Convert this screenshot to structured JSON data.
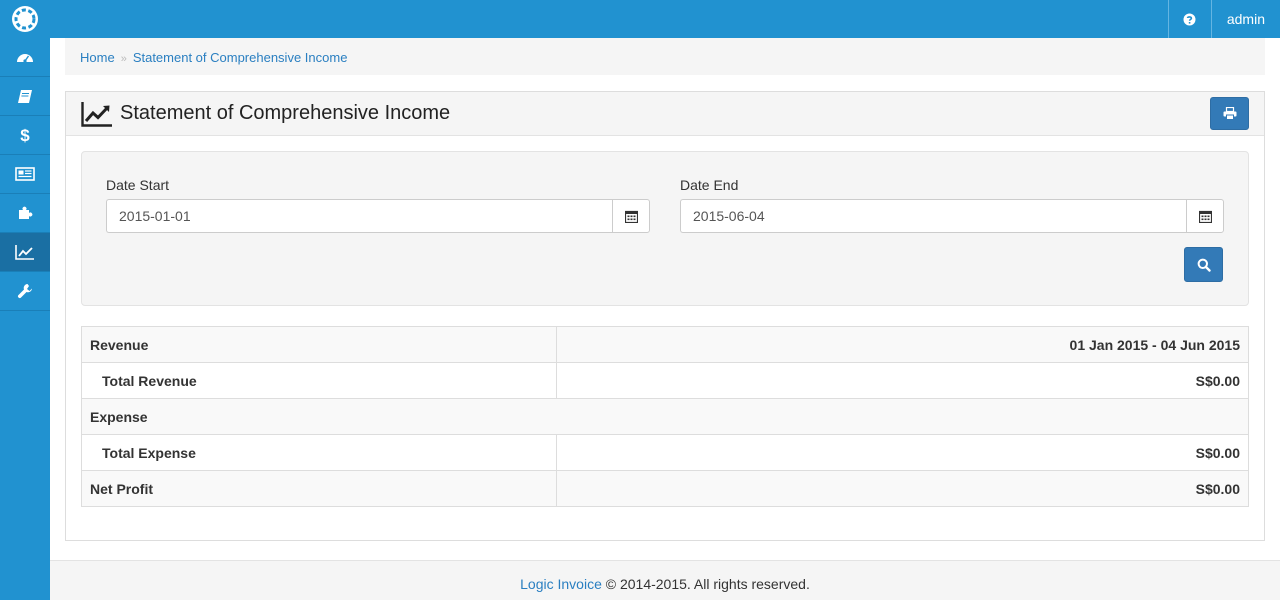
{
  "topbar": {
    "admin_label": "admin"
  },
  "sidebar": {
    "items": [
      {
        "icon": "dashboard-icon"
      },
      {
        "icon": "book-icon"
      },
      {
        "icon": "dollar-icon"
      },
      {
        "icon": "newspaper-icon"
      },
      {
        "icon": "puzzle-icon"
      },
      {
        "icon": "line-chart-icon",
        "active": true
      },
      {
        "icon": "wrench-icon"
      }
    ]
  },
  "breadcrumb": {
    "home": "Home",
    "separator": "»",
    "current": "Statement of Comprehensive Income"
  },
  "panel": {
    "title": "Statement of Comprehensive Income"
  },
  "filters": {
    "date_start_label": "Date Start",
    "date_start_value": "2015-01-01",
    "date_end_label": "Date End",
    "date_end_value": "2015-06-04"
  },
  "report": {
    "revenue_label": "Revenue",
    "period": "01 Jan 2015 - 04 Jun 2015",
    "total_revenue_label": "Total Revenue",
    "total_revenue_value": "S$0.00",
    "expense_label": "Expense",
    "total_expense_label": "Total Expense",
    "total_expense_value": "S$0.00",
    "net_profit_label": "Net Profit",
    "net_profit_value": "S$0.00"
  },
  "footer": {
    "brand_link": "Logic Invoice",
    "copyright": " © 2014-2015. All rights reserved."
  },
  "colors": {
    "brand": "#2192d0",
    "button": "#337ab7",
    "link": "#2a7fc1"
  }
}
